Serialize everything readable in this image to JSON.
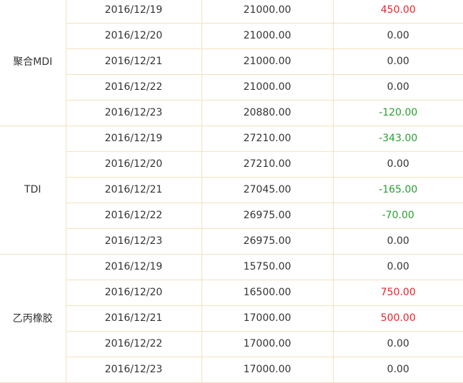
{
  "colors": {
    "up": "#e8262d",
    "down": "#27a02f",
    "flat": "#333333",
    "border": "#f3e2bd"
  },
  "groups": [
    {
      "product": "聚合MDI",
      "rows": [
        {
          "date": "2016/12/19",
          "price": "21000.00",
          "change": "450.00",
          "trend": "up"
        },
        {
          "date": "2016/12/20",
          "price": "21000.00",
          "change": "0.00",
          "trend": "flat"
        },
        {
          "date": "2016/12/21",
          "price": "21000.00",
          "change": "0.00",
          "trend": "flat"
        },
        {
          "date": "2016/12/22",
          "price": "21000.00",
          "change": "0.00",
          "trend": "flat"
        },
        {
          "date": "2016/12/23",
          "price": "20880.00",
          "change": "-120.00",
          "trend": "down"
        }
      ]
    },
    {
      "product": "TDI",
      "rows": [
        {
          "date": "2016/12/19",
          "price": "27210.00",
          "change": "-343.00",
          "trend": "down"
        },
        {
          "date": "2016/12/20",
          "price": "27210.00",
          "change": "0.00",
          "trend": "flat"
        },
        {
          "date": "2016/12/21",
          "price": "27045.00",
          "change": "-165.00",
          "trend": "down"
        },
        {
          "date": "2016/12/22",
          "price": "26975.00",
          "change": "-70.00",
          "trend": "down"
        },
        {
          "date": "2016/12/23",
          "price": "26975.00",
          "change": "0.00",
          "trend": "flat"
        }
      ]
    },
    {
      "product": "乙丙橡胶",
      "rows": [
        {
          "date": "2016/12/19",
          "price": "15750.00",
          "change": "0.00",
          "trend": "flat"
        },
        {
          "date": "2016/12/20",
          "price": "16500.00",
          "change": "750.00",
          "trend": "up"
        },
        {
          "date": "2016/12/21",
          "price": "17000.00",
          "change": "500.00",
          "trend": "up"
        },
        {
          "date": "2016/12/22",
          "price": "17000.00",
          "change": "0.00",
          "trend": "flat"
        },
        {
          "date": "2016/12/23",
          "price": "17000.00",
          "change": "0.00",
          "trend": "flat"
        }
      ]
    }
  ]
}
